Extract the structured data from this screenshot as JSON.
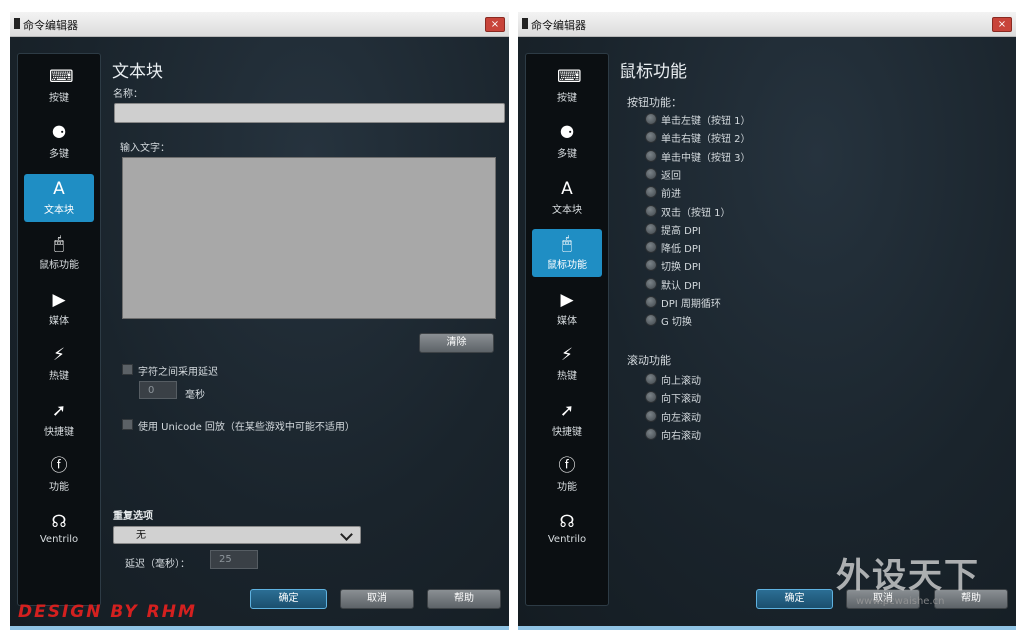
{
  "left": {
    "window_title": "命令编辑器",
    "close_glyph": "×",
    "sidebar": [
      {
        "label": "按键",
        "icon": "key-icon",
        "glyph": "⌨"
      },
      {
        "label": "多键",
        "icon": "multikey-icon",
        "glyph": "⚈"
      },
      {
        "label": "文本块",
        "icon": "text-block-icon",
        "glyph": "A"
      },
      {
        "label": "鼠标功能",
        "icon": "mouse-icon",
        "glyph": "🖱"
      },
      {
        "label": "媒体",
        "icon": "media-play-icon",
        "glyph": "▶"
      },
      {
        "label": "热键",
        "icon": "hotkey-icon",
        "glyph": "⚡"
      },
      {
        "label": "快捷键",
        "icon": "shortcut-arrow-icon",
        "glyph": "➚"
      },
      {
        "label": "功能",
        "icon": "function-icon",
        "glyph": "ⓕ"
      },
      {
        "label": "Ventrilo",
        "icon": "ventrilo-headset-icon",
        "glyph": "☊"
      }
    ],
    "active_index": 2,
    "heading": "文本块",
    "name_label": "名称：",
    "name_value": "",
    "input_label": "输入文字：",
    "input_value": "",
    "clear_button": "清除",
    "delay_checkbox_label": "字符之间采用延迟",
    "delay_value": "0",
    "delay_unit": "毫秒",
    "unicode_checkbox_label": "使用 Unicode 回放（在某些游戏中可能不适用）",
    "repeat_label": "重复选项",
    "repeat_value": "无",
    "repeat_delay_label": "延迟（毫秒）：",
    "repeat_delay_value": "25",
    "ok_button": "确定",
    "cancel_button": "取消",
    "help_button": "帮助",
    "credit": "DESIGN BY RHM"
  },
  "right": {
    "window_title": "命令编辑器",
    "close_glyph": "×",
    "active_index": 3,
    "heading": "鼠标功能",
    "button_section_label": "按钮功能：",
    "button_options": [
      "单击左键（按钮 1）",
      "单击右键（按钮 2）",
      "单击中键（按钮 3）",
      "返回",
      "前进",
      "双击（按钮 1）",
      "提高 DPI",
      "降低 DPI",
      "切换 DPI",
      "默认 DPI",
      "DPI 周期循环",
      "G 切换"
    ],
    "scroll_section_label": "滚动功能",
    "scroll_options": [
      "向上滚动",
      "向下滚动",
      "向左滚动",
      "向右滚动"
    ],
    "ok_button": "确定",
    "cancel_button": "取消",
    "help_button": "帮助"
  },
  "watermark": {
    "text": "外设天下",
    "url": "www.pcwaishe.cn"
  },
  "colors": {
    "accent": "#1f8ec4",
    "panel": "#1b252e",
    "credit": "#d4201f"
  }
}
